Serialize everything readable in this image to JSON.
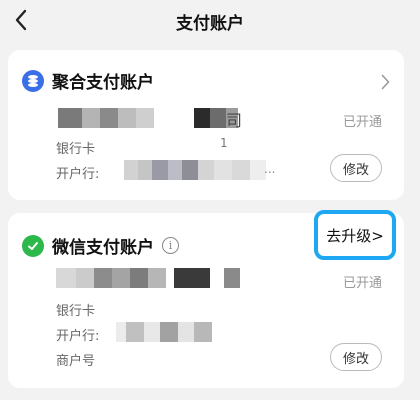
{
  "header": {
    "title": "支付账户"
  },
  "cards": [
    {
      "title": "聚合支付账户",
      "partial_name_suffix": "司",
      "partial_bank_suffix": "1",
      "partial_branch_suffix": "...",
      "status": "已开通",
      "label_bank": "银行卡",
      "label_branch": "开户行:",
      "edit_label": "修改"
    },
    {
      "title": "微信支付账户",
      "info_glyph": "i",
      "upgrade_label": "去升级>",
      "status": "已开通",
      "label_bank": "银行卡",
      "label_branch": "开户行:",
      "label_merchant": "商户号",
      "edit_label": "修改"
    }
  ],
  "icons": {
    "back": "chevron-left-icon",
    "chevron": "chevron-right-icon",
    "aggregate": "stack-coins-icon",
    "wechat": "wechat-pay-icon",
    "info": "info-circle-icon"
  },
  "colors": {
    "blue_icon": "#3a6fe8",
    "green_icon": "#2db84b",
    "highlight_border": "#1ea7f2"
  }
}
